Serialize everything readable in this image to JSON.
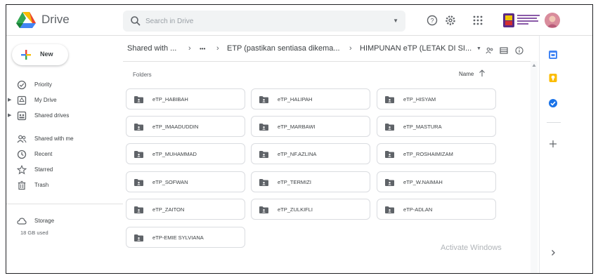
{
  "app": {
    "name": "Drive"
  },
  "search": {
    "placeholder": "Search in Drive"
  },
  "sidebar": {
    "new_label": "New",
    "items": [
      {
        "label": "Priority",
        "icon": "priority-icon"
      },
      {
        "label": "My Drive",
        "icon": "my-drive-icon"
      },
      {
        "label": "Shared drives",
        "icon": "shared-drives-icon"
      },
      {
        "label": "Shared with me",
        "icon": "shared-with-me-icon"
      },
      {
        "label": "Recent",
        "icon": "recent-icon"
      },
      {
        "label": "Starred",
        "icon": "star-icon"
      },
      {
        "label": "Trash",
        "icon": "trash-icon"
      },
      {
        "label": "Storage",
        "icon": "cloud-icon"
      }
    ],
    "storage_used": "18 GB used"
  },
  "breadcrumb": {
    "items": [
      "Shared with ...",
      "•••",
      "ETP (pastikan sentiasa dikema...",
      "HIMPUNAN eTP (LETAK DI SI..."
    ]
  },
  "main": {
    "folders_label": "Folders",
    "sort_label": "Name",
    "folders": [
      "eTP_HABIBAH",
      "eTP_HALIPAH",
      "eTP_HISYAM",
      "eTP_IMAADUDDIN",
      "eTP_MARBAWI",
      "eTP_MASTURA",
      "eTP_MUHAMMAD",
      "eTP_NF.AZLINA",
      "eTP_ROSHAIMIZAM",
      "eTP_SOFWAN",
      "eTP_TERMIZI",
      "eTP_W.NAIMAH",
      "eTP_ZAITON",
      "eTP_ZULKIFLI",
      "eTP-ADLAN",
      "eTP-EMIE SYLVIANA"
    ]
  },
  "watermark": "Activate Windows",
  "colors": {
    "accent_blue": "#4285f4",
    "accent_green": "#34a853",
    "accent_yellow": "#fbbc04",
    "accent_red": "#ea4335",
    "folder_icon": "#5f6368"
  }
}
